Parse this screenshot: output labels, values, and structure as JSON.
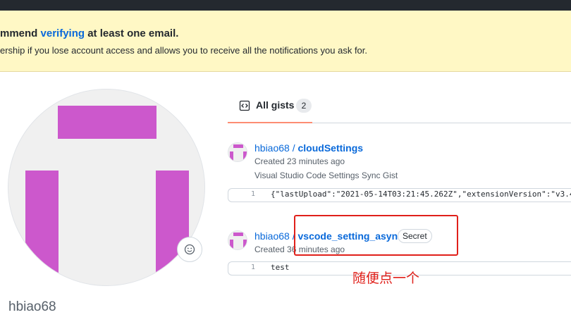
{
  "banner": {
    "title_prefix": "mmend ",
    "title_link": "verifying",
    "title_suffix": " at least one email.",
    "subtitle": "ership if you lose account access and allows you to receive all the notifications you ask for."
  },
  "profile": {
    "username": "hbiao68",
    "emoji_icon": "smiley-icon"
  },
  "tabs": [
    {
      "label": "All gists",
      "count": "2",
      "icon": "code-square-icon"
    }
  ],
  "gists": [
    {
      "owner": "hbiao68",
      "separator": "/",
      "name": "cloudSettings",
      "created": "Created 23 minutes ago",
      "description": "Visual Studio Code Settings Sync Gist",
      "line_number": "1",
      "code": "{\"lastUpload\":\"2021-05-14T03:21:45.262Z\",\"extensionVersion\":\"v3.4"
    },
    {
      "owner": "hbiao68",
      "separator": "/",
      "name": "vscode_setting_async",
      "badge": "Secret",
      "created": "Created 36 minutes ago",
      "line_number": "1",
      "code": "test"
    }
  ],
  "annotation": {
    "text": "随便点一个",
    "color": "#e0201a"
  },
  "colors": {
    "accent": "#0969da",
    "avatar_magenta": "#cc58cc",
    "banner_bg": "#fff8c5",
    "tab_underline": "#fd8c73"
  }
}
